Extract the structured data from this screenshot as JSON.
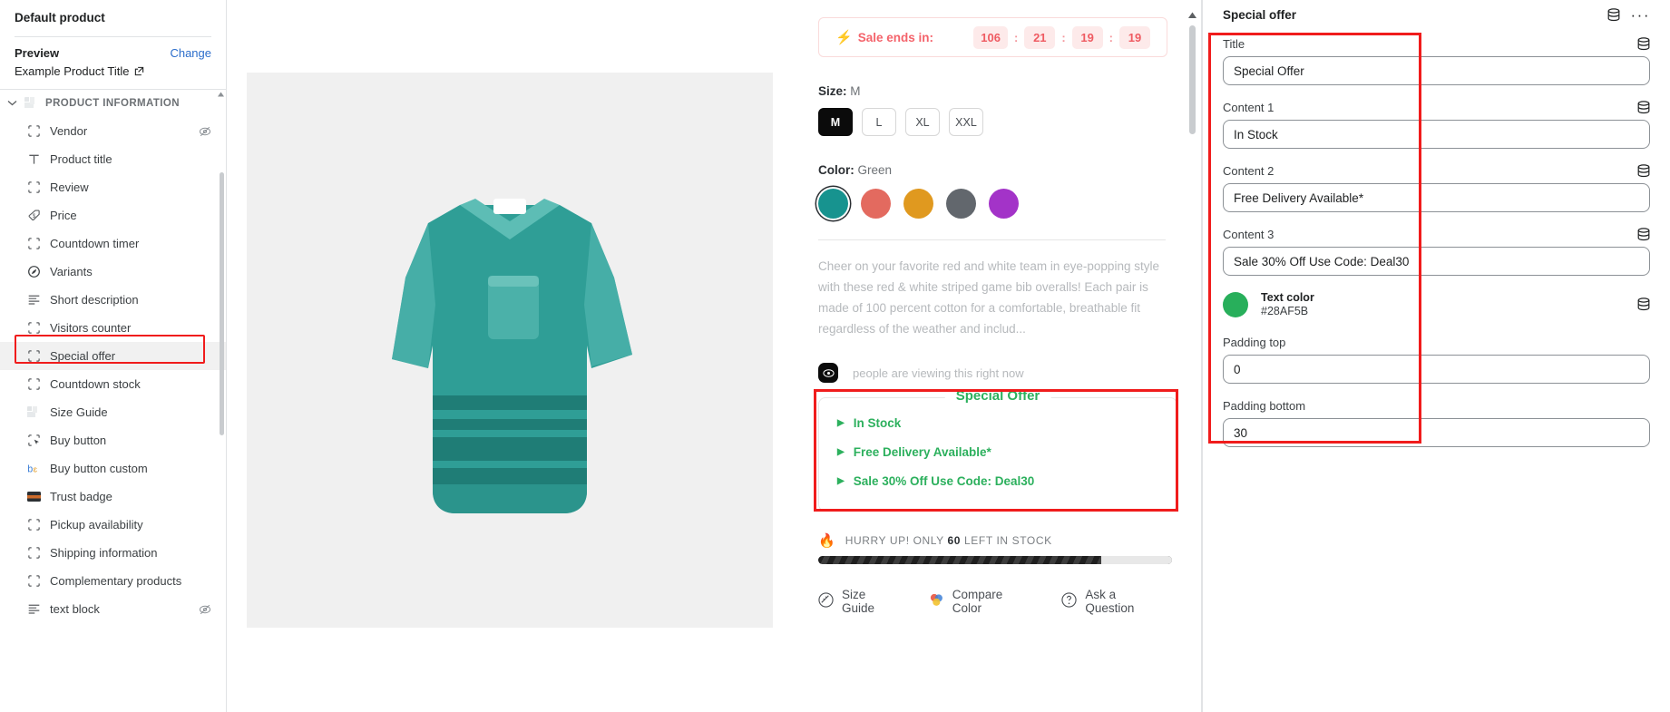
{
  "sidebar": {
    "title": "Default product",
    "preview": {
      "label": "Preview",
      "change_label": "Change",
      "product_title": "Example Product Title"
    },
    "group": {
      "label": "PRODUCT INFORMATION",
      "chevron": "chevron-down"
    },
    "items": [
      {
        "label": "Vendor",
        "icon": "placeholder-block-icon",
        "hidden": true
      },
      {
        "label": "Product title",
        "icon": "text-type-icon",
        "hidden": false
      },
      {
        "label": "Review",
        "icon": "placeholder-block-icon",
        "hidden": false
      },
      {
        "label": "Price",
        "icon": "price-tag-icon",
        "hidden": false
      },
      {
        "label": "Countdown timer",
        "icon": "placeholder-block-icon",
        "hidden": false
      },
      {
        "label": "Variants",
        "icon": "variants-icon",
        "hidden": false
      },
      {
        "label": "Short description",
        "icon": "text-lines-icon",
        "hidden": false
      },
      {
        "label": "Visitors counter",
        "icon": "placeholder-block-icon",
        "hidden": false
      },
      {
        "label": "Special offer",
        "icon": "placeholder-block-icon",
        "hidden": false,
        "selected": true
      },
      {
        "label": "Countdown stock",
        "icon": "placeholder-block-icon",
        "hidden": false
      },
      {
        "label": "Size Guide",
        "icon": "image-thumb-icon",
        "hidden": false
      },
      {
        "label": "Buy button",
        "icon": "cursor-button-icon",
        "hidden": false
      },
      {
        "label": "Buy button custom",
        "icon": "buy-custom-icon",
        "hidden": false
      },
      {
        "label": "Trust badge",
        "icon": "trust-badge-icon",
        "hidden": false
      },
      {
        "label": "Pickup availability",
        "icon": "placeholder-block-icon",
        "hidden": false
      },
      {
        "label": "Shipping information",
        "icon": "placeholder-block-icon",
        "hidden": false
      },
      {
        "label": "Complementary products",
        "icon": "placeholder-block-icon",
        "hidden": false
      },
      {
        "label": "text block",
        "icon": "text-lines-icon",
        "hidden": true
      }
    ]
  },
  "preview": {
    "sale_banner": {
      "label": "Sale ends in:",
      "bolt_icon": "lightning-bolt-icon",
      "units": [
        "106",
        "21",
        "19",
        "19"
      ],
      "separator": ":"
    },
    "size": {
      "label": "Size:",
      "value": "M",
      "options": [
        "M",
        "L",
        "XL",
        "XXL"
      ],
      "selected": "M"
    },
    "color": {
      "label": "Color:",
      "value": "Green",
      "swatches": [
        "#17938f",
        "#e36a5f",
        "#e0991f",
        "#62676d",
        "#a333c8"
      ],
      "selected_index": 0
    },
    "description": "Cheer on your favorite red and white team in eye-popping style with these red & white striped game bib overalls! Each pair is made of 100 percent cotton for a comfortable, breathable fit regardless of the weather and includ...",
    "viewers": {
      "icon": "eye-icon",
      "text": "people are viewing this right now"
    },
    "special_offer": {
      "legend": "Special Offer",
      "items": [
        "In Stock",
        "Free Delivery Available*",
        "Sale 30% Off Use Code: Deal30"
      ],
      "bullet_icon": "triangle-right-icon",
      "color": "#2CB05D"
    },
    "stock": {
      "fire_icon": "fire-icon",
      "prefix": "HURRY UP! ONLY",
      "count": "60",
      "suffix": "LEFT IN STOCK"
    },
    "footer_links": [
      {
        "label": "Size Guide",
        "icon": "ruler-icon"
      },
      {
        "label": "Compare Color",
        "icon": "palette-icon"
      },
      {
        "label": "Ask a Question",
        "icon": "question-circle-icon"
      }
    ]
  },
  "panel": {
    "title": "Special offer",
    "header_icons": [
      "database-icon",
      "more-options-icon"
    ],
    "fields": [
      {
        "label": "Title",
        "value": "Special Offer",
        "icon": "database-icon"
      },
      {
        "label": "Content 1",
        "value": "In Stock",
        "icon": "database-icon"
      },
      {
        "label": "Content 2",
        "value": "Free Delivery Available*",
        "icon": "database-icon"
      },
      {
        "label": "Content 3",
        "value": "Sale 30% Off Use Code: Deal30",
        "icon": "database-icon"
      }
    ],
    "text_color": {
      "label": "Text color",
      "hex": "#28AF5B",
      "icon": "database-icon"
    },
    "padding_top": {
      "label": "Padding top",
      "value": "0"
    },
    "padding_bottom": {
      "label": "Padding bottom",
      "value": "30"
    }
  },
  "colors": {
    "highlight": "#F01C1C",
    "accent_green": "#2CB05D",
    "sale_red": "#F4636B",
    "link_blue": "#2C6ECB"
  }
}
